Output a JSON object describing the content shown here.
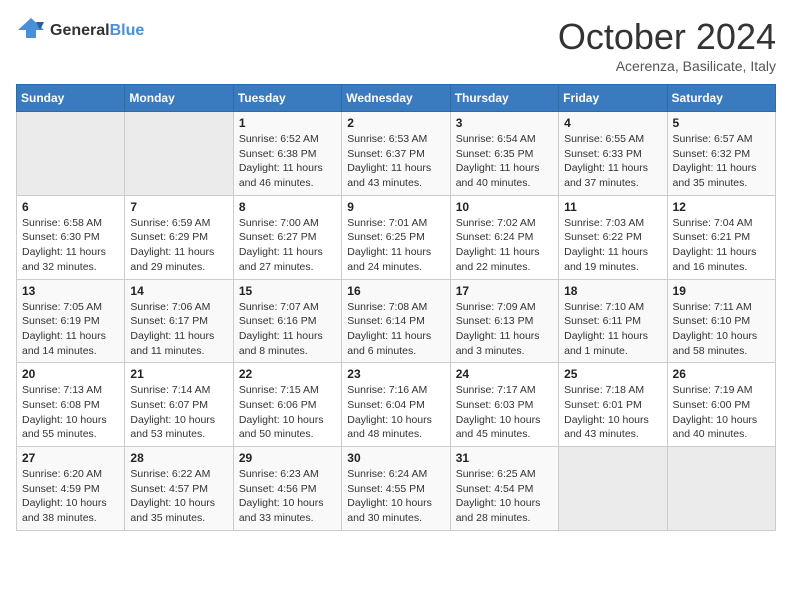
{
  "logo": {
    "line1": "General",
    "line2": "Blue"
  },
  "title": "October 2024",
  "subtitle": "Acerenza, Basilicate, Italy",
  "days_of_week": [
    "Sunday",
    "Monday",
    "Tuesday",
    "Wednesday",
    "Thursday",
    "Friday",
    "Saturday"
  ],
  "weeks": [
    [
      {
        "num": "",
        "info": ""
      },
      {
        "num": "",
        "info": ""
      },
      {
        "num": "1",
        "info": "Sunrise: 6:52 AM\nSunset: 6:38 PM\nDaylight: 11 hours and 46 minutes."
      },
      {
        "num": "2",
        "info": "Sunrise: 6:53 AM\nSunset: 6:37 PM\nDaylight: 11 hours and 43 minutes."
      },
      {
        "num": "3",
        "info": "Sunrise: 6:54 AM\nSunset: 6:35 PM\nDaylight: 11 hours and 40 minutes."
      },
      {
        "num": "4",
        "info": "Sunrise: 6:55 AM\nSunset: 6:33 PM\nDaylight: 11 hours and 37 minutes."
      },
      {
        "num": "5",
        "info": "Sunrise: 6:57 AM\nSunset: 6:32 PM\nDaylight: 11 hours and 35 minutes."
      }
    ],
    [
      {
        "num": "6",
        "info": "Sunrise: 6:58 AM\nSunset: 6:30 PM\nDaylight: 11 hours and 32 minutes."
      },
      {
        "num": "7",
        "info": "Sunrise: 6:59 AM\nSunset: 6:29 PM\nDaylight: 11 hours and 29 minutes."
      },
      {
        "num": "8",
        "info": "Sunrise: 7:00 AM\nSunset: 6:27 PM\nDaylight: 11 hours and 27 minutes."
      },
      {
        "num": "9",
        "info": "Sunrise: 7:01 AM\nSunset: 6:25 PM\nDaylight: 11 hours and 24 minutes."
      },
      {
        "num": "10",
        "info": "Sunrise: 7:02 AM\nSunset: 6:24 PM\nDaylight: 11 hours and 22 minutes."
      },
      {
        "num": "11",
        "info": "Sunrise: 7:03 AM\nSunset: 6:22 PM\nDaylight: 11 hours and 19 minutes."
      },
      {
        "num": "12",
        "info": "Sunrise: 7:04 AM\nSunset: 6:21 PM\nDaylight: 11 hours and 16 minutes."
      }
    ],
    [
      {
        "num": "13",
        "info": "Sunrise: 7:05 AM\nSunset: 6:19 PM\nDaylight: 11 hours and 14 minutes."
      },
      {
        "num": "14",
        "info": "Sunrise: 7:06 AM\nSunset: 6:17 PM\nDaylight: 11 hours and 11 minutes."
      },
      {
        "num": "15",
        "info": "Sunrise: 7:07 AM\nSunset: 6:16 PM\nDaylight: 11 hours and 8 minutes."
      },
      {
        "num": "16",
        "info": "Sunrise: 7:08 AM\nSunset: 6:14 PM\nDaylight: 11 hours and 6 minutes."
      },
      {
        "num": "17",
        "info": "Sunrise: 7:09 AM\nSunset: 6:13 PM\nDaylight: 11 hours and 3 minutes."
      },
      {
        "num": "18",
        "info": "Sunrise: 7:10 AM\nSunset: 6:11 PM\nDaylight: 11 hours and 1 minute."
      },
      {
        "num": "19",
        "info": "Sunrise: 7:11 AM\nSunset: 6:10 PM\nDaylight: 10 hours and 58 minutes."
      }
    ],
    [
      {
        "num": "20",
        "info": "Sunrise: 7:13 AM\nSunset: 6:08 PM\nDaylight: 10 hours and 55 minutes."
      },
      {
        "num": "21",
        "info": "Sunrise: 7:14 AM\nSunset: 6:07 PM\nDaylight: 10 hours and 53 minutes."
      },
      {
        "num": "22",
        "info": "Sunrise: 7:15 AM\nSunset: 6:06 PM\nDaylight: 10 hours and 50 minutes."
      },
      {
        "num": "23",
        "info": "Sunrise: 7:16 AM\nSunset: 6:04 PM\nDaylight: 10 hours and 48 minutes."
      },
      {
        "num": "24",
        "info": "Sunrise: 7:17 AM\nSunset: 6:03 PM\nDaylight: 10 hours and 45 minutes."
      },
      {
        "num": "25",
        "info": "Sunrise: 7:18 AM\nSunset: 6:01 PM\nDaylight: 10 hours and 43 minutes."
      },
      {
        "num": "26",
        "info": "Sunrise: 7:19 AM\nSunset: 6:00 PM\nDaylight: 10 hours and 40 minutes."
      }
    ],
    [
      {
        "num": "27",
        "info": "Sunrise: 6:20 AM\nSunset: 4:59 PM\nDaylight: 10 hours and 38 minutes."
      },
      {
        "num": "28",
        "info": "Sunrise: 6:22 AM\nSunset: 4:57 PM\nDaylight: 10 hours and 35 minutes."
      },
      {
        "num": "29",
        "info": "Sunrise: 6:23 AM\nSunset: 4:56 PM\nDaylight: 10 hours and 33 minutes."
      },
      {
        "num": "30",
        "info": "Sunrise: 6:24 AM\nSunset: 4:55 PM\nDaylight: 10 hours and 30 minutes."
      },
      {
        "num": "31",
        "info": "Sunrise: 6:25 AM\nSunset: 4:54 PM\nDaylight: 10 hours and 28 minutes."
      },
      {
        "num": "",
        "info": ""
      },
      {
        "num": "",
        "info": ""
      }
    ]
  ]
}
